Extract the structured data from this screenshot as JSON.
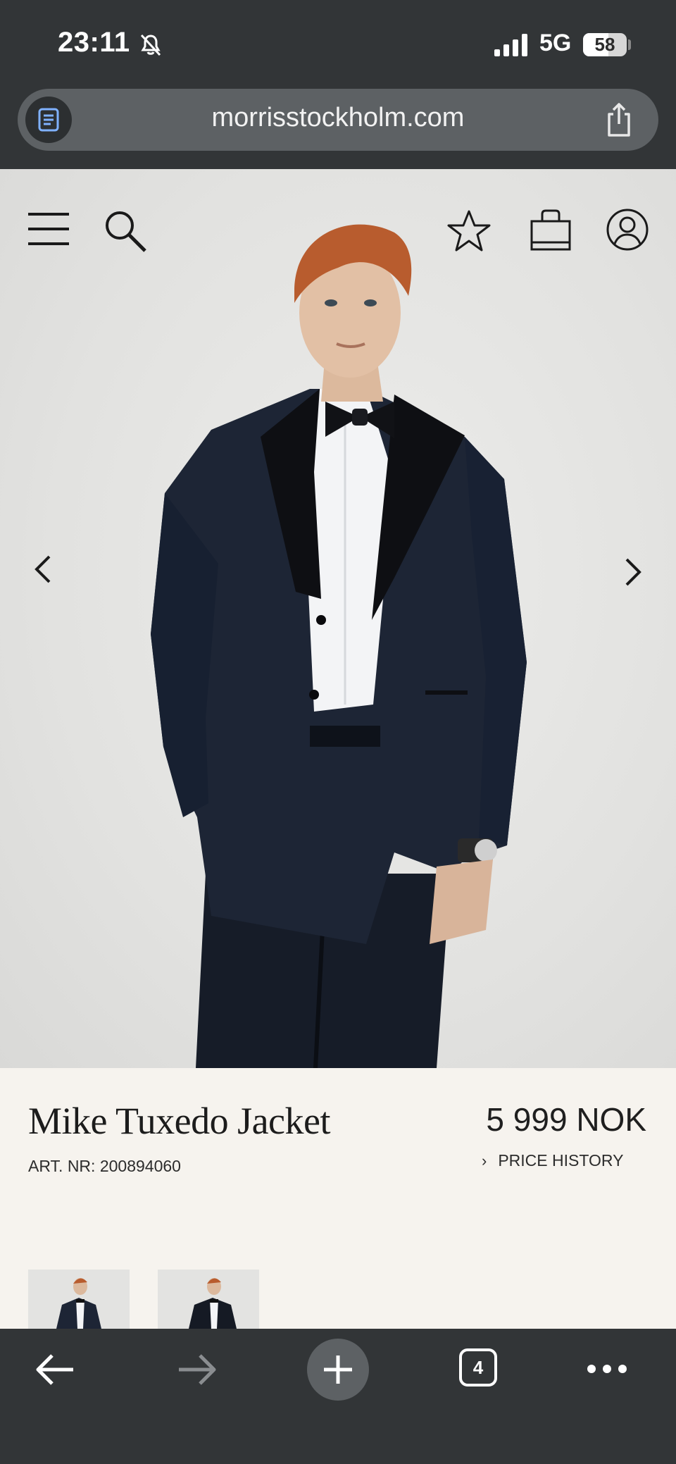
{
  "status_bar": {
    "time": "23:11",
    "network": "5G",
    "battery": "58",
    "battery_level_percent": 58,
    "icons": [
      "bell-slash-icon",
      "signal-icon"
    ]
  },
  "browser": {
    "url": "morrisstockholm.com",
    "open_tab_count": "4",
    "icons": [
      "reader-icon",
      "share-icon",
      "back-arrow-icon",
      "forward-arrow-icon",
      "plus-icon",
      "tabs-icon",
      "more-icon"
    ]
  },
  "site_nav": {
    "icons": [
      "menu-icon",
      "search-icon",
      "star-icon",
      "shopping-bag-icon",
      "account-icon"
    ]
  },
  "gallery": {
    "icons": [
      "chevron-left-icon",
      "chevron-right-icon"
    ]
  },
  "product": {
    "title": "Mike Tuxedo Jacket",
    "article_number": "ART. NR: 200894060",
    "price": "5 999 NOK",
    "price_history_label": "PRICE HISTORY"
  },
  "colors": {
    "chrome_background": "#323537",
    "url_bar": "#5d6164",
    "page_background": "#f6f3ee",
    "hero_background": "#e4e4e2",
    "tuxedo_navy": "#1c2432",
    "lapel_black": "#0e0f12"
  }
}
